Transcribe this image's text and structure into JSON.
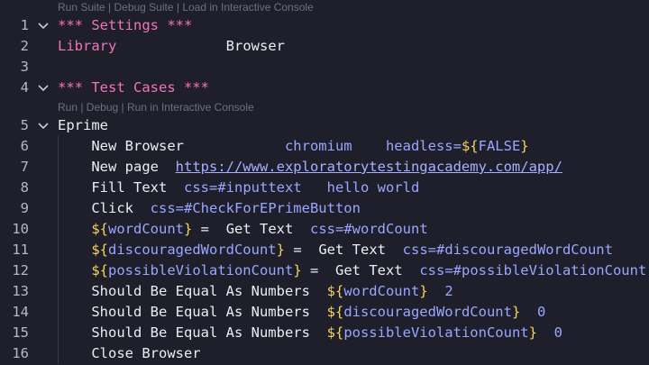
{
  "colors": {
    "background": "#1e1f2b",
    "section_header": "#f274b8",
    "keyword": "#ecedf2",
    "argument": "#9aa6ff",
    "variable_brace": "#f5d45a",
    "code_lens": "#6c7086"
  },
  "codelens": {
    "suite": "Run Suite | Debug Suite | Load in Interactive Console",
    "test": "Run | Debug | Run in Interactive Console"
  },
  "lines": [
    {
      "n": "1",
      "fold": true,
      "indent": false,
      "tokens": [
        {
          "t": "*** Settings ***",
          "c": "pink"
        }
      ]
    },
    {
      "n": "2",
      "fold": false,
      "indent": false,
      "tokens": [
        {
          "t": "Library",
          "c": "pink"
        },
        {
          "t": "             "
        },
        {
          "t": "Browser",
          "c": "white"
        }
      ]
    },
    {
      "n": "3",
      "fold": false,
      "indent": false,
      "tokens": []
    },
    {
      "n": "4",
      "fold": true,
      "indent": false,
      "tokens": [
        {
          "t": "*** Test Cases ***",
          "c": "pink"
        }
      ]
    },
    {
      "n": "5",
      "fold": true,
      "indent": false,
      "tokens": [
        {
          "t": "Eprime",
          "c": "white"
        }
      ]
    },
    {
      "n": "6",
      "fold": false,
      "indent": true,
      "tokens": [
        {
          "t": "    "
        },
        {
          "t": "New Browser",
          "c": "white"
        },
        {
          "t": "            "
        },
        {
          "t": "chromium",
          "c": "blue"
        },
        {
          "t": "    "
        },
        {
          "t": "headless=",
          "c": "blue"
        },
        {
          "t": "${",
          "c": "yel"
        },
        {
          "t": "FALSE",
          "c": "blue"
        },
        {
          "t": "}",
          "c": "yel"
        }
      ]
    },
    {
      "n": "7",
      "fold": false,
      "indent": true,
      "tokens": [
        {
          "t": "    "
        },
        {
          "t": "New page",
          "c": "white"
        },
        {
          "t": "  "
        },
        {
          "t": "https://www.exploratorytestingacademy.com/app/",
          "c": "url"
        }
      ]
    },
    {
      "n": "8",
      "fold": false,
      "indent": true,
      "tokens": [
        {
          "t": "    "
        },
        {
          "t": "Fill Text",
          "c": "white"
        },
        {
          "t": "  "
        },
        {
          "t": "css=#inputtext",
          "c": "blue"
        },
        {
          "t": "   "
        },
        {
          "t": "hello world",
          "c": "blue"
        }
      ]
    },
    {
      "n": "9",
      "fold": false,
      "indent": true,
      "tokens": [
        {
          "t": "    "
        },
        {
          "t": "Click",
          "c": "white"
        },
        {
          "t": "  "
        },
        {
          "t": "css=#CheckForEPrimeButton",
          "c": "blue"
        }
      ]
    },
    {
      "n": "10",
      "fold": false,
      "indent": true,
      "tokens": [
        {
          "t": "    "
        },
        {
          "t": "${",
          "c": "yel"
        },
        {
          "t": "wordCount",
          "c": "blue"
        },
        {
          "t": "}",
          "c": "yel"
        },
        {
          "t": " = ",
          "c": "white"
        },
        {
          "t": " "
        },
        {
          "t": "Get Text",
          "c": "white"
        },
        {
          "t": "  "
        },
        {
          "t": "css=#wordCount",
          "c": "blue"
        }
      ]
    },
    {
      "n": "11",
      "fold": false,
      "indent": true,
      "tokens": [
        {
          "t": "    "
        },
        {
          "t": "${",
          "c": "yel"
        },
        {
          "t": "discouragedWordCount",
          "c": "blue"
        },
        {
          "t": "}",
          "c": "yel"
        },
        {
          "t": " = ",
          "c": "white"
        },
        {
          "t": " "
        },
        {
          "t": "Get Text",
          "c": "white"
        },
        {
          "t": "  "
        },
        {
          "t": "css=#discouragedWordCount",
          "c": "blue"
        }
      ]
    },
    {
      "n": "12",
      "fold": false,
      "indent": true,
      "tokens": [
        {
          "t": "    "
        },
        {
          "t": "${",
          "c": "yel"
        },
        {
          "t": "possibleViolationCount",
          "c": "blue"
        },
        {
          "t": "}",
          "c": "yel"
        },
        {
          "t": " = ",
          "c": "white"
        },
        {
          "t": " "
        },
        {
          "t": "Get Text",
          "c": "white"
        },
        {
          "t": "  "
        },
        {
          "t": "css=#possibleViolationCount",
          "c": "blue"
        }
      ]
    },
    {
      "n": "13",
      "fold": false,
      "indent": true,
      "tokens": [
        {
          "t": "    "
        },
        {
          "t": "Should Be Equal As Numbers",
          "c": "white"
        },
        {
          "t": "  "
        },
        {
          "t": "${",
          "c": "yel"
        },
        {
          "t": "wordCount",
          "c": "blue"
        },
        {
          "t": "}",
          "c": "yel"
        },
        {
          "t": "  "
        },
        {
          "t": "2",
          "c": "blue"
        }
      ]
    },
    {
      "n": "14",
      "fold": false,
      "indent": true,
      "tokens": [
        {
          "t": "    "
        },
        {
          "t": "Should Be Equal As Numbers",
          "c": "white"
        },
        {
          "t": "  "
        },
        {
          "t": "${",
          "c": "yel"
        },
        {
          "t": "discouragedWordCount",
          "c": "blue"
        },
        {
          "t": "}",
          "c": "yel"
        },
        {
          "t": "  "
        },
        {
          "t": "0",
          "c": "blue"
        }
      ]
    },
    {
      "n": "15",
      "fold": false,
      "indent": true,
      "tokens": [
        {
          "t": "    "
        },
        {
          "t": "Should Be Equal As Numbers",
          "c": "white"
        },
        {
          "t": "  "
        },
        {
          "t": "${",
          "c": "yel"
        },
        {
          "t": "possibleViolationCount",
          "c": "blue"
        },
        {
          "t": "}",
          "c": "yel"
        },
        {
          "t": "  "
        },
        {
          "t": "0",
          "c": "blue"
        }
      ]
    },
    {
      "n": "16",
      "fold": false,
      "indent": true,
      "tokens": [
        {
          "t": "    "
        },
        {
          "t": "Close Browser",
          "c": "white"
        }
      ]
    }
  ]
}
